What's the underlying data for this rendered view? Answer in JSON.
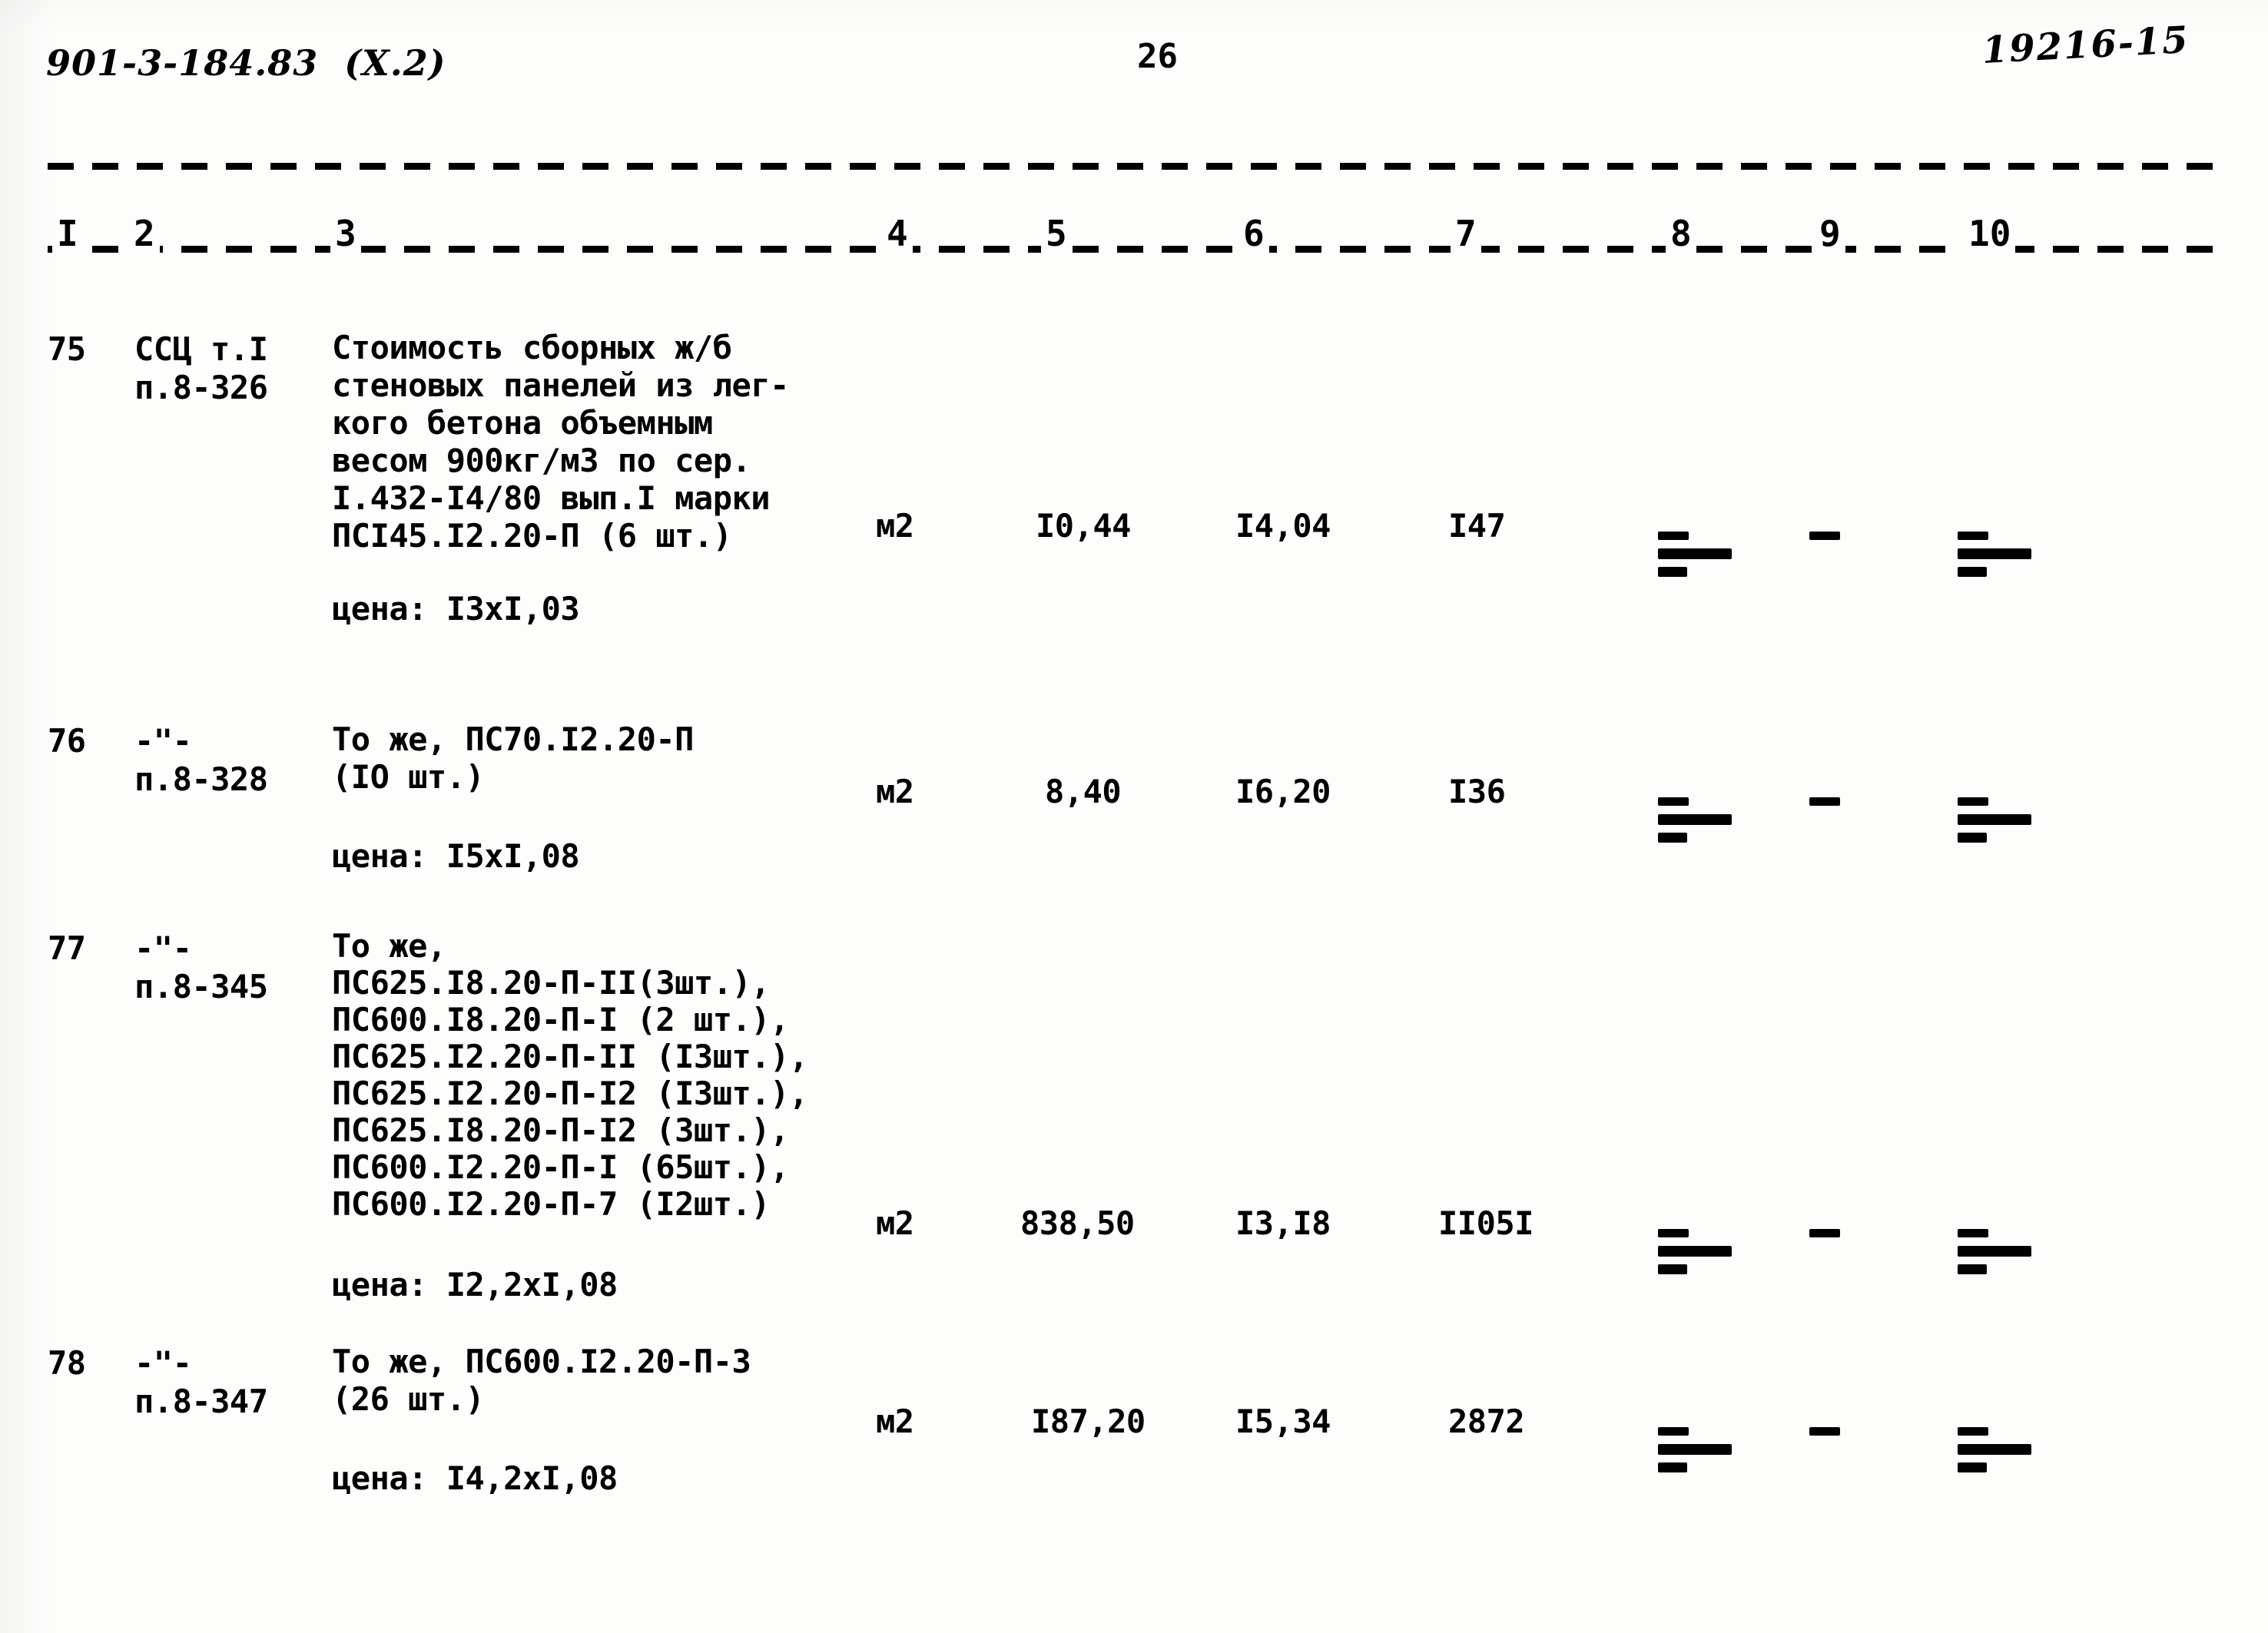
{
  "header": {
    "doc_code": "901-3-184.83  (X.2)",
    "page_number": "26",
    "archive_code": "19216-15"
  },
  "table": {
    "column_numbers": [
      "I",
      "2",
      "3",
      "4",
      "5",
      "6",
      "7",
      "8",
      "9",
      "10"
    ],
    "rows": [
      {
        "pos": "75",
        "justification_line1": "ССЦ т.I",
        "justification_line2": "п.8-326",
        "description": "Стоимость сборных ж/б\nстеновых панелей из лег-\nкого бетона объемным\nвесом 900кг/м3 по сер.\nI.432-I4/80 вып.I марки\nПСI45.I2.20-П (6 шт.)",
        "price_note": "цена: I3xI,03",
        "unit": "м2",
        "col5": "I0,44",
        "col6": "I4,04",
        "col7": "I47",
        "col8": "dash-cluster",
        "col9": "dash-single",
        "col10": "dash-cluster"
      },
      {
        "pos": "76",
        "justification_line1": "-\"-",
        "justification_line2": "п.8-328",
        "description": "То же, ПС70.I2.20-П\n(IO шт.)",
        "price_note": "цена: I5xI,08",
        "unit": "м2",
        "col5": "8,40",
        "col6": "I6,20",
        "col7": "I36",
        "col8": "dash-cluster",
        "col9": "dash-single",
        "col10": "dash-cluster"
      },
      {
        "pos": "77",
        "justification_line1": "-\"-",
        "justification_line2": "п.8-345",
        "description": "То же,\nПС625.I8.20-П-II(3шт.),\nПС600.I8.20-П-I (2 шт.),\nПС625.I2.20-П-II (I3шт.),\nПС625.I2.20-П-I2 (I3шт.),\nПС625.I8.20-П-I2 (3шт.),\nПС600.I2.20-П-I (65шт.),\nПС600.I2.20-П-7 (I2шт.)",
        "price_note": "цена: I2,2xI,08",
        "unit": "м2",
        "col5": "838,50",
        "col6": "I3,I8",
        "col7": "II05I",
        "col8": "dash-cluster",
        "col9": "dash-single",
        "col10": "dash-cluster"
      },
      {
        "pos": "78",
        "justification_line1": "-\"-",
        "justification_line2": "п.8-347",
        "description": "То же, ПС600.I2.20-П-3\n(26 шт.)",
        "price_note": "цена: I4,2xI,08",
        "unit": "м2",
        "col5": "I87,20",
        "col6": "I5,34",
        "col7": "2872",
        "col8": "dash-cluster",
        "col9": "dash-single",
        "col10": "dash-cluster"
      }
    ]
  }
}
